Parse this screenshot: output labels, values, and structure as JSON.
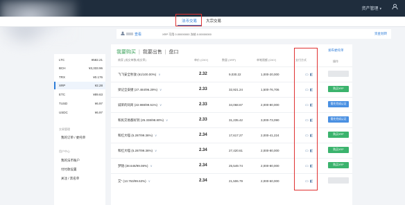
{
  "topbar": {
    "menu_label": "资产管理",
    "user_icon": "user-icon"
  },
  "subnav": {
    "tabs": [
      {
        "label": "法币交易"
      },
      {
        "label": "大宗交易"
      }
    ]
  },
  "userbar": {
    "view_label": "查看",
    "balance_text": "XRP  可用 0.00000000  冻结 0.00000000",
    "withdraw_label": "资金划转"
  },
  "sidebar": {
    "coins": [
      {
        "symbol": "LTC",
        "price": "¥582.21"
      },
      {
        "symbol": "BCH",
        "price": "¥3,333.96"
      },
      {
        "symbol": "TRX",
        "price": "¥0.176"
      },
      {
        "symbol": "XRP",
        "price": "¥2.28",
        "selected": true
      },
      {
        "symbol": "ETC",
        "price": "¥89.63"
      },
      {
        "symbol": "TUSD",
        "price": "¥6.97"
      },
      {
        "symbol": "USDC",
        "price": "¥6.97"
      }
    ],
    "section1_title": "交易管理",
    "section1_links": [
      "我的订单 / 委托单"
    ],
    "section2_title": "用户中心",
    "section2_links": [
      "我的法币账户",
      "付付款设置",
      "关注 / 黑名单"
    ]
  },
  "main": {
    "crumbs": [
      "我要购买",
      "我要出售",
      "盘口"
    ],
    "crumb_sep": "|",
    "right_link": "发布委托单",
    "headers": {
      "merchant": "商家 (成交单数/成交率)",
      "unit_price": "单价 (CNY)",
      "quantity": "数量 (XRP)",
      "limit": "单笔限额 (CNY)",
      "payment": "支付方式",
      "action": "操作"
    },
    "rows": [
      {
        "merchant": "飞飞安全秒放 (61/100.00%)",
        "price": "2.32",
        "qty": "9,030.22",
        "limit": "1,000-20,000",
        "action": "",
        "action_type": "dis"
      },
      {
        "merchant": "梁记全安捷 (27.484/96.29%)",
        "price": "2.33",
        "qty": "32,921.24",
        "limit": "1,500-76,706",
        "action": "购买XRP",
        "action_type": "buy"
      },
      {
        "merchant": "诚荣的同商 (22.988/99.51%)",
        "price": "2.33",
        "qty": "34,068.67",
        "limit": "2,000-80,000",
        "action": "需先完成认证",
        "action_type": "verify"
      },
      {
        "merchant": "和民交易都好到 (25.338/98.80%)",
        "price": "2.33",
        "qty": "31,235.42",
        "limit": "3,000-73,090",
        "action": "需先完成认证",
        "action_type": "verify"
      },
      {
        "merchant": "和红大喵 (5.287/99.36%)",
        "price": "2.34",
        "qty": "17,617.27",
        "limit": "2,000-41,224",
        "action": "购买XRP",
        "action_type": "buy"
      },
      {
        "merchant": "和红大喵 (5.287/99.36%)",
        "price": "2.34",
        "qty": "27,420.61",
        "limit": "2,000-80,000",
        "action": "购买XRP",
        "action_type": "buy"
      },
      {
        "merchant": "梦随 (38.646/99.08%)",
        "price": "2.34",
        "qty": "25,549.74",
        "limit": "2,000-80,000",
        "action": "购买XRP",
        "action_type": "buy"
      },
      {
        "merchant": "艾\" (13.753/99.63%)",
        "price": "2.34",
        "qty": "21,506.79",
        "limit": "2,000-50,000",
        "action": "",
        "action_type": "dis"
      }
    ]
  }
}
